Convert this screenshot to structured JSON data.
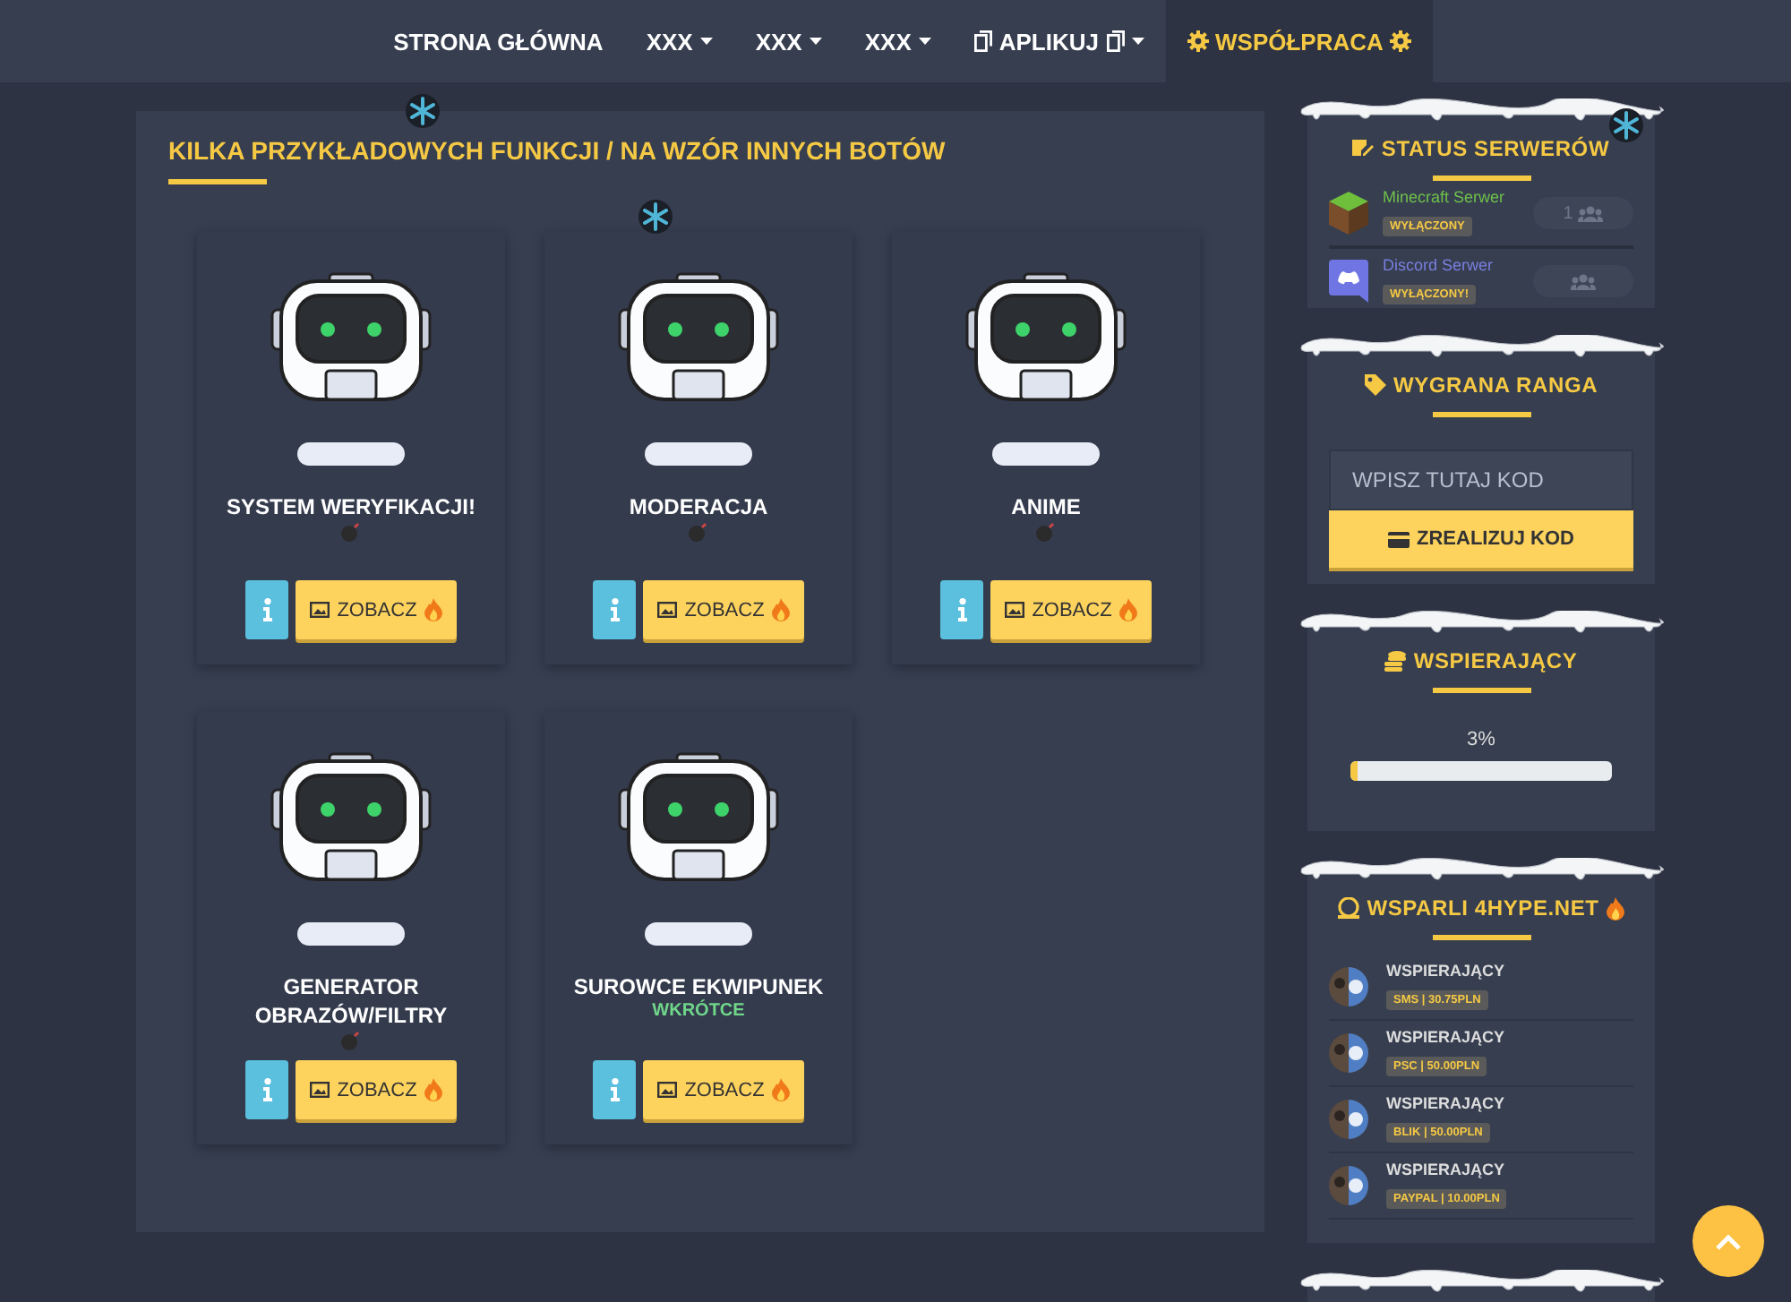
{
  "nav": [
    {
      "label": "STRONA GŁÓWNA",
      "dropdown": false,
      "kind": "plain",
      "selected": false
    },
    {
      "label": "XXX",
      "dropdown": true,
      "kind": "plain",
      "selected": false
    },
    {
      "label": "XXX",
      "dropdown": true,
      "kind": "plain",
      "selected": false
    },
    {
      "label": "XXX",
      "dropdown": true,
      "kind": "plain",
      "selected": false
    },
    {
      "label": "APLIKUJ",
      "dropdown": true,
      "kind": "copy",
      "selected": false
    },
    {
      "label": "WSPÓŁPRACA",
      "dropdown": false,
      "kind": "gear",
      "selected": true
    }
  ],
  "features": {
    "title": "KILKA PRZYKŁADOWYCH FUNKCJI / NA WZÓR INNYCH BOTÓW",
    "cards": [
      {
        "title": "SYSTEM WERYFIKACJI!",
        "kind": "bomb",
        "button": "ZOBACZ"
      },
      {
        "title": "MODERACJA",
        "kind": "bomb",
        "button": "ZOBACZ"
      },
      {
        "title": "ANIME",
        "kind": "bomb",
        "button": "ZOBACZ"
      },
      {
        "title": "GENERATOR OBRAZÓW/FILTRY",
        "kind": "bomb",
        "button": "ZOBACZ"
      },
      {
        "title": "SUROWCE EKWIPUNEK",
        "kind": "note",
        "note": "WKRÓTCE",
        "button": "ZOBACZ"
      }
    ]
  },
  "status": {
    "title": "STATUS SERWERÓW",
    "servers": [
      {
        "name": "Minecraft Serwer",
        "kind": "minecraft",
        "color": "#6fc04a",
        "status": "WYŁĄCZONY",
        "players": "1"
      },
      {
        "name": "Discord Serwer",
        "kind": "discord",
        "color": "#7a7fe0",
        "status": "WYŁĄCZONY!"
      }
    ]
  },
  "rank": {
    "title": "WYGRANA RANGA",
    "placeholder": "WPISZ TUTAJ KOD",
    "button": "ZREALIZUJ KOD"
  },
  "support": {
    "title": "WSPIERAJĄCY",
    "reading": "3%",
    "level": 0.03
  },
  "donors": {
    "title": "WSPARLI 4HYPE.NET",
    "items": [
      {
        "name": "WSPIERAJĄCY",
        "amount": "SMS | 30.75PLN"
      },
      {
        "name": "WSPIERAJĄCY",
        "amount": "PSC | 50.00PLN"
      },
      {
        "name": "WSPIERAJĄCY",
        "amount": "BLIK | 50.00PLN"
      },
      {
        "name": "WSPIERAJĄCY",
        "amount": "PAYPAL | 10.00PLN"
      }
    ]
  }
}
